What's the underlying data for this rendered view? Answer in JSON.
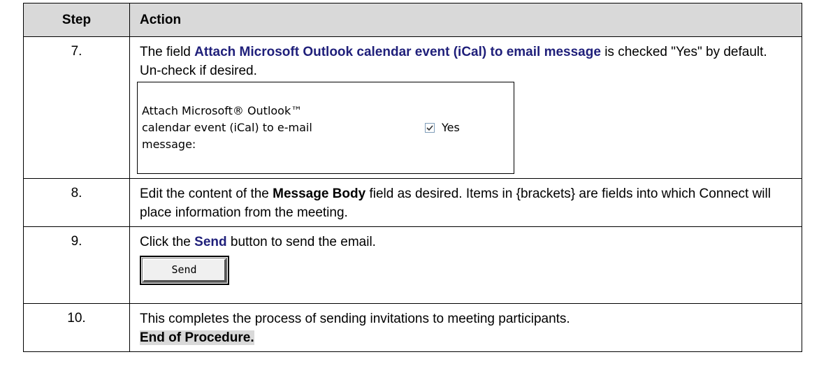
{
  "header": {
    "step": "Step",
    "action": "Action"
  },
  "rows": [
    {
      "num": "7.",
      "text_a": "The field ",
      "field_name": "Attach Microsoft Outlook calendar event (iCal) to email message",
      "text_b": " is checked \"Yes\" by default.  Un-check if desired.",
      "ui_label": "Attach Microsoft® Outlook™ calendar event (iCal) to e-mail message:",
      "ui_checkbox_label": "Yes"
    },
    {
      "num": "8.",
      "text_a": "Edit the content of the ",
      "field_name": "Message Body",
      "text_b": " field as desired.  Items in {brackets} are fields into which Connect will place information from the meeting."
    },
    {
      "num": "9.",
      "text_a": "Click the ",
      "field_name": "Send",
      "text_b": " button to send the email.",
      "button_label": "Send"
    },
    {
      "num": "10.",
      "text_a": "This completes the process of sending invitations to meeting participants.",
      "end_text": "End of Procedure."
    }
  ]
}
